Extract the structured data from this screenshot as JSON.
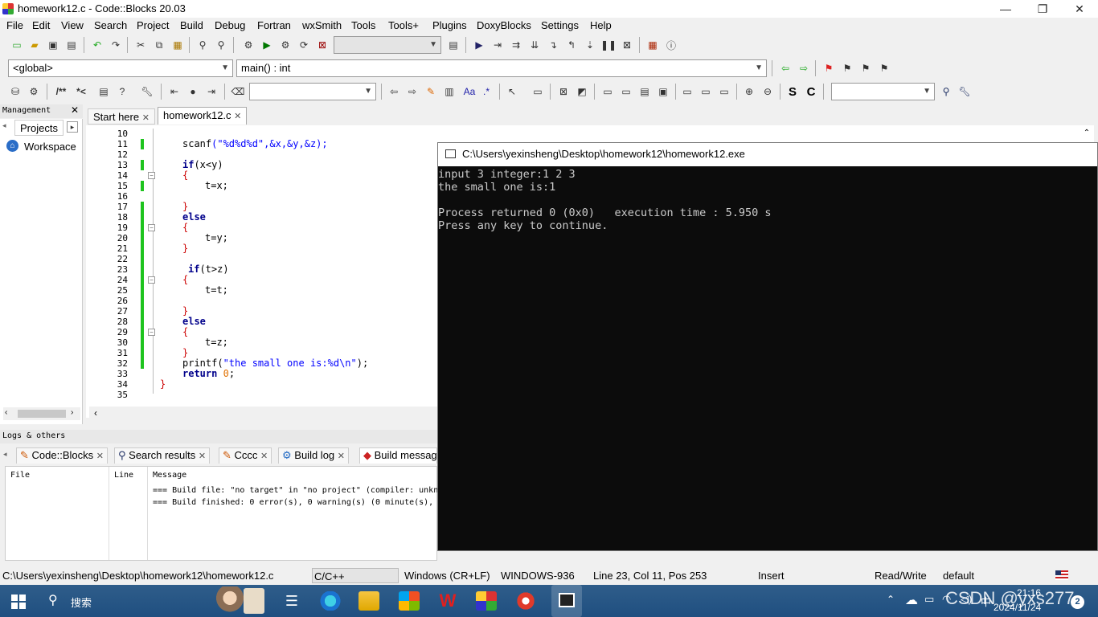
{
  "window": {
    "title": "homework12.c - Code::Blocks 20.03",
    "min": "—",
    "max": "❐",
    "close": "✕"
  },
  "menu": [
    "File",
    "Edit",
    "View",
    "Search",
    "Project",
    "Build",
    "Debug",
    "Fortran",
    "wxSmith",
    "Tools",
    "Tools+",
    "Plugins",
    "DoxyBlocks",
    "Settings",
    "Help"
  ],
  "toolbar": {
    "scope_combo": "<global>",
    "func_combo": "main() : int",
    "regex_label": ".*"
  },
  "management": {
    "header": "Management",
    "tab_projects": "Projects",
    "workspace": "Workspace"
  },
  "editor": {
    "tab_start": "Start here",
    "tab_file": "homework12.c",
    "lines": [
      {
        "n": "10",
        "code": ""
      },
      {
        "n": "11",
        "code": "scanf"
      },
      {
        "n": "12",
        "code": ""
      },
      {
        "n": "13",
        "code": "if"
      },
      {
        "n": "14",
        "code": "{"
      },
      {
        "n": "15",
        "code": "t=x;"
      },
      {
        "n": "16",
        "code": ""
      },
      {
        "n": "17",
        "code": "}"
      },
      {
        "n": "18",
        "code": "else"
      },
      {
        "n": "19",
        "code": "{"
      },
      {
        "n": "20",
        "code": "t=y;"
      },
      {
        "n": "21",
        "code": "}"
      },
      {
        "n": "22",
        "code": ""
      },
      {
        "n": "23",
        "code": "if"
      },
      {
        "n": "24",
        "code": "{"
      },
      {
        "n": "25",
        "code": "t=t;"
      },
      {
        "n": "26",
        "code": ""
      },
      {
        "n": "27",
        "code": "}"
      },
      {
        "n": "28",
        "code": "else"
      },
      {
        "n": "29",
        "code": "{"
      },
      {
        "n": "30",
        "code": "t=z;"
      },
      {
        "n": "31",
        "code": "}"
      },
      {
        "n": "32",
        "code": "printf"
      },
      {
        "n": "33",
        "code": "return"
      },
      {
        "n": "34",
        "code": "}"
      },
      {
        "n": "35",
        "code": ""
      }
    ],
    "scanf_args": "(\"%d%d%d\",&x,&y,&z);",
    "if1_cond": "(x<y)",
    "if2_cond": "(t>z)",
    "printf_str": "\"the small one is:%d\\n\"",
    "return_val": "0"
  },
  "console": {
    "title": "C:\\Users\\yexinsheng\\Desktop\\homework12\\homework12.exe",
    "lines": [
      "input 3 integer:1 2 3",
      "the small one is:1",
      "",
      "Process returned 0 (0x0)   execution time : 5.950 s",
      "Press any key to continue."
    ]
  },
  "logs": {
    "header": "Logs & others",
    "tabs": [
      "Code::Blocks",
      "Search results",
      "Cccc",
      "Build log",
      "Build messag"
    ],
    "col_file": "File",
    "col_line": "Line",
    "col_message": "Message",
    "msg1": "=== Build file: \"no target\" in \"no project\" (compiler: unkn",
    "msg2": "=== Build finished: 0 error(s), 0 warning(s) (0 minute(s),"
  },
  "status": {
    "path": "C:\\Users\\yexinsheng\\Desktop\\homework12\\homework12.c",
    "lang": "C/C++",
    "eol": "Windows (CR+LF)",
    "encoding": "WINDOWS-936",
    "position": "Line 23, Col 11, Pos 253",
    "mode": "Insert",
    "access": "Read/Write",
    "profile": "default"
  },
  "taskbar": {
    "search": "搜索",
    "time": "21:16",
    "date": "2024/11/24",
    "ime": "中",
    "notify_count": "2",
    "watermark": "CSDN @yxs277"
  }
}
